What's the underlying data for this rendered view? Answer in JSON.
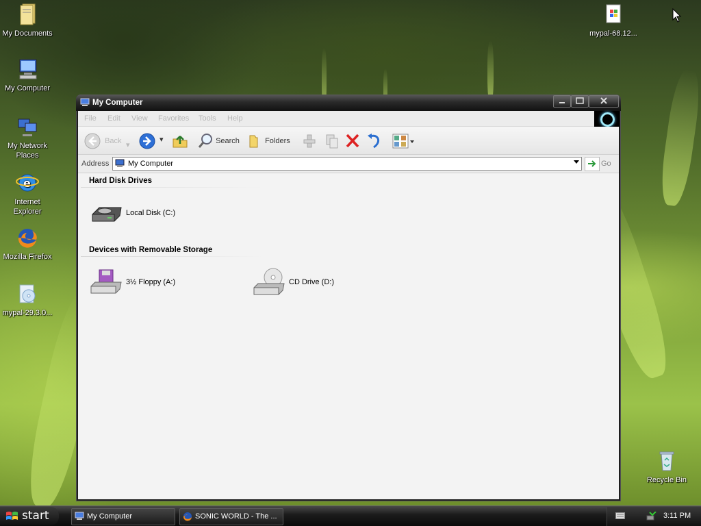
{
  "desktop": {
    "icons": [
      {
        "label": "My Documents"
      },
      {
        "label": "My Computer"
      },
      {
        "label": "My Network Places"
      },
      {
        "label": "Internet Explorer"
      },
      {
        "label": "Mozilla Firefox"
      },
      {
        "label": "mypal-29.3.0..."
      },
      {
        "label": "mypal-68.12..."
      },
      {
        "label": "Recycle Bin"
      }
    ]
  },
  "window": {
    "title": "My Computer",
    "menu": [
      "File",
      "Edit",
      "View",
      "Favorites",
      "Tools",
      "Help"
    ],
    "toolbar": {
      "back": "Back",
      "search": "Search",
      "folders": "Folders"
    },
    "address": {
      "label": "Address",
      "value": "My Computer",
      "go": "Go"
    },
    "groups": [
      {
        "title": "Hard Disk Drives",
        "items": [
          "Local Disk (C:)"
        ]
      },
      {
        "title": "Devices with Removable Storage",
        "items": [
          "3½ Floppy (A:)",
          "CD Drive (D:)"
        ]
      }
    ]
  },
  "taskbar": {
    "start": "start",
    "tasks": [
      "My Computer",
      "SONIC WORLD - The ..."
    ],
    "clock": "3:11 PM"
  },
  "colors": {
    "accent_ring": "#9fe8f7",
    "titlebar": "#2a2a2a",
    "content_bg": "#f3f3f3"
  }
}
